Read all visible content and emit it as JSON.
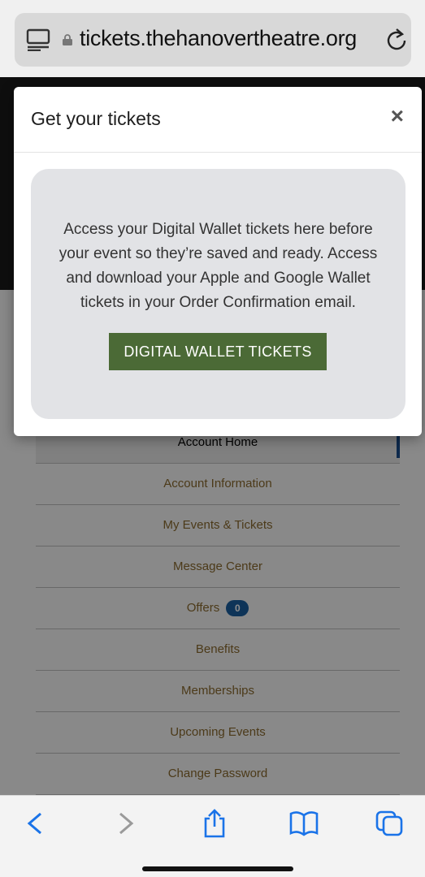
{
  "browser": {
    "url": "tickets.thehanovertheatre.org"
  },
  "modal": {
    "title": "Get your tickets",
    "close_label": "×",
    "message": "Access your Digital Wallet tickets here before your event so they’re saved and ready. Access and download your Apple and Google Wallet tickets in your Order Confirmation email.",
    "button_label": "DIGITAL WALLET TICKETS"
  },
  "account_menu": {
    "items": [
      {
        "label": "Account Home",
        "active": true
      },
      {
        "label": "Account Information"
      },
      {
        "label": "My Events & Tickets"
      },
      {
        "label": "Message Center"
      },
      {
        "label": "Offers",
        "badge": "0"
      },
      {
        "label": "Benefits"
      },
      {
        "label": "Memberships"
      },
      {
        "label": "Upcoming Events"
      },
      {
        "label": "Change Password"
      }
    ]
  },
  "toolbar": {
    "icons": [
      "back-icon",
      "forward-icon",
      "share-icon",
      "bookmarks-icon",
      "tabs-icon"
    ]
  },
  "colors": {
    "wallet_button": "#4b6a36",
    "menu_link": "#8a6a2e",
    "badge": "#1a5fa0",
    "ios_blue": "#1a73e8"
  }
}
